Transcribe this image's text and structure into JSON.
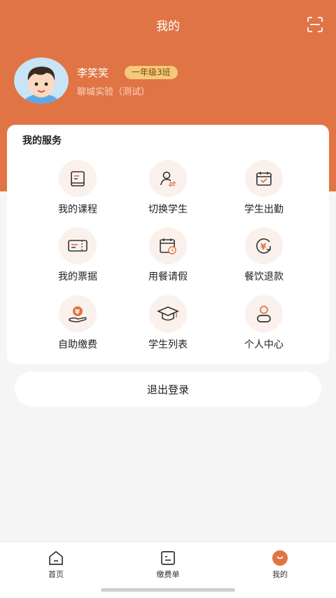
{
  "header": {
    "title": "我的",
    "scan_icon": "scan-icon"
  },
  "profile": {
    "name": "李笑笑",
    "grade": "一年级3班",
    "school": "聊城实验（测试）"
  },
  "services": {
    "title": "我的服务",
    "items": [
      {
        "label": "我的课程",
        "icon": "course-book-icon"
      },
      {
        "label": "切换学生",
        "icon": "switch-student-icon"
      },
      {
        "label": "学生出勤",
        "icon": "attendance-calendar-icon"
      },
      {
        "label": "我的票据",
        "icon": "receipt-icon"
      },
      {
        "label": "用餐请假",
        "icon": "meal-leave-calendar-icon"
      },
      {
        "label": "餐饮退款",
        "icon": "refund-icon"
      },
      {
        "label": "自助缴费",
        "icon": "payment-hand-icon"
      },
      {
        "label": "学生列表",
        "icon": "graduation-cap-icon"
      },
      {
        "label": "个人中心",
        "icon": "person-icon"
      }
    ]
  },
  "logout_label": "退出登录",
  "tabbar": {
    "items": [
      {
        "label": "首页",
        "icon": "home-icon"
      },
      {
        "label": "缴费单",
        "icon": "bill-icon"
      },
      {
        "label": "我的",
        "icon": "mine-icon"
      }
    ]
  },
  "colors": {
    "accent": "#e17444",
    "badge": "#f5c87a",
    "background": "#f5f5f5"
  }
}
